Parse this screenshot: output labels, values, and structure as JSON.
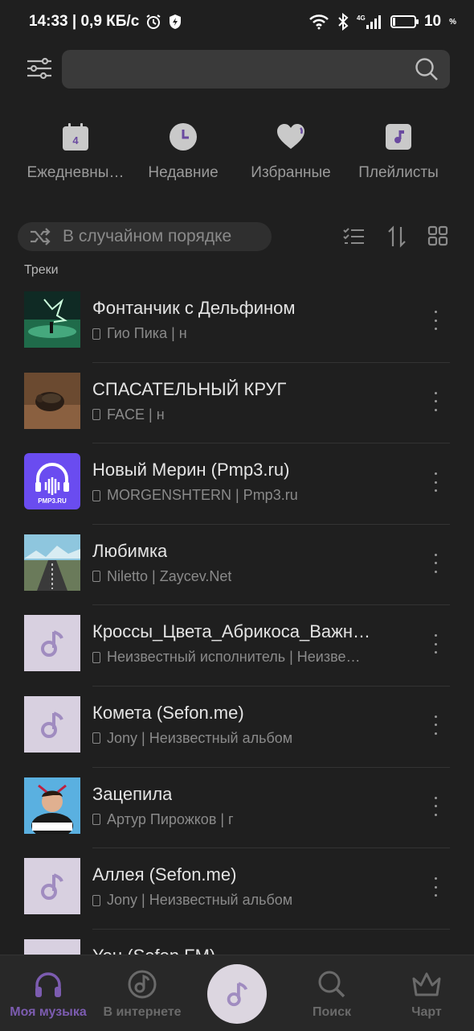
{
  "status_bar": {
    "time_speed": "14:33 | 0,9 КБ/с",
    "network": "4G",
    "battery_percent": "10",
    "battery_unit": "%"
  },
  "search": {
    "placeholder": ""
  },
  "categories": [
    {
      "label": "Ежедневны…",
      "icon": "calendar-icon",
      "badge": "4"
    },
    {
      "label": "Недавние",
      "icon": "clock-icon"
    },
    {
      "label": "Избранные",
      "icon": "heart-icon"
    },
    {
      "label": "Плейлисты",
      "icon": "playlist-icon"
    }
  ],
  "shuffle": {
    "label": "В случайном порядке"
  },
  "section": {
    "label": "Треки"
  },
  "tracks": [
    {
      "title": "Фонтанчик с Дельфином",
      "subtitle": "Гио Пика | н",
      "cover": "dark-green-artwork"
    },
    {
      "title": "СПАСАТЕЛЬНЫЙ КРУГ",
      "subtitle": "FACE | н",
      "cover": "beetle-artwork"
    },
    {
      "title": "Новый Мерин (Pmp3.ru)",
      "subtitle": "MORGENSHTERN | Pmp3.ru",
      "cover": "pmp3-logo",
      "cover_text": "PMP3.RU"
    },
    {
      "title": "Любимка",
      "subtitle": "Niletto | Zaycev.Net",
      "cover": "road-mountain-artwork"
    },
    {
      "title": "Кроссы_Цвета_Абрикоса_Важн…",
      "subtitle": "Неизвестный исполнитель | Неизве…",
      "cover": "placeholder-note"
    },
    {
      "title": "Комета (Sefon.me)",
      "subtitle": "Jony | Неизвестный альбом",
      "cover": "placeholder-note"
    },
    {
      "title": "Зацепила",
      "subtitle": "Артур Пирожков | г",
      "cover": "zacepila-artwork"
    },
    {
      "title": "Аллея (Sefon.me)",
      "subtitle": "Jony | Неизвестный альбом",
      "cover": "placeholder-note"
    },
    {
      "title": "You (Sefon.FM)",
      "subtitle": "",
      "cover": "placeholder-note"
    }
  ],
  "bottom_nav": [
    {
      "label": "Моя музыка",
      "icon": "headphones-icon",
      "active": true
    },
    {
      "label": "В интернете",
      "icon": "disc-icon",
      "active": false
    },
    {
      "label": "",
      "icon": "music-note-icon",
      "active": false
    },
    {
      "label": "Поиск",
      "icon": "search-icon",
      "active": false
    },
    {
      "label": "Чарт",
      "icon": "crown-icon",
      "active": false
    }
  ],
  "colors": {
    "accent": "#7c5cb0",
    "background": "#1f1f1f",
    "surface": "#3a3a3a"
  }
}
